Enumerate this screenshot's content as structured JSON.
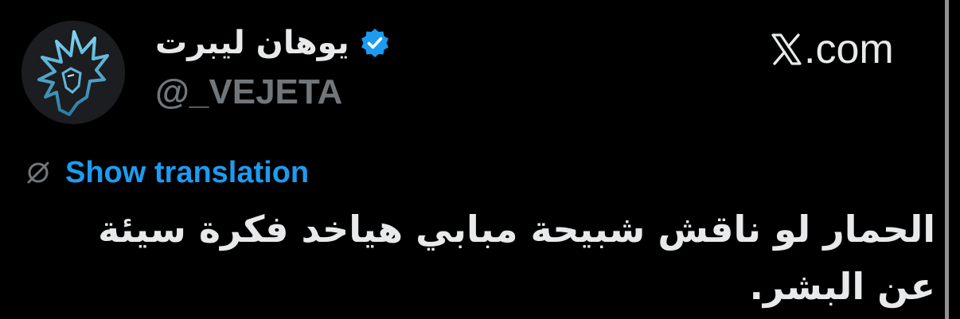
{
  "author": {
    "display_name": "يوهان ليبرت",
    "handle": "@_VEJETA",
    "verified": true,
    "avatar_icon": "anime-character-avatar"
  },
  "site": {
    "logo_icon": "x-logo-icon",
    "label": ".com"
  },
  "translation": {
    "icon": "globe-slash-icon",
    "label": "Show translation"
  },
  "tweet": {
    "text": "الحمار لو ناقش شبيحة مبابي هياخد فكرة سيئة عن البشر."
  },
  "colors": {
    "background": "#000000",
    "primary_text": "#e7e9ea",
    "secondary_text": "#71767b",
    "accent": "#1d9bf0"
  }
}
